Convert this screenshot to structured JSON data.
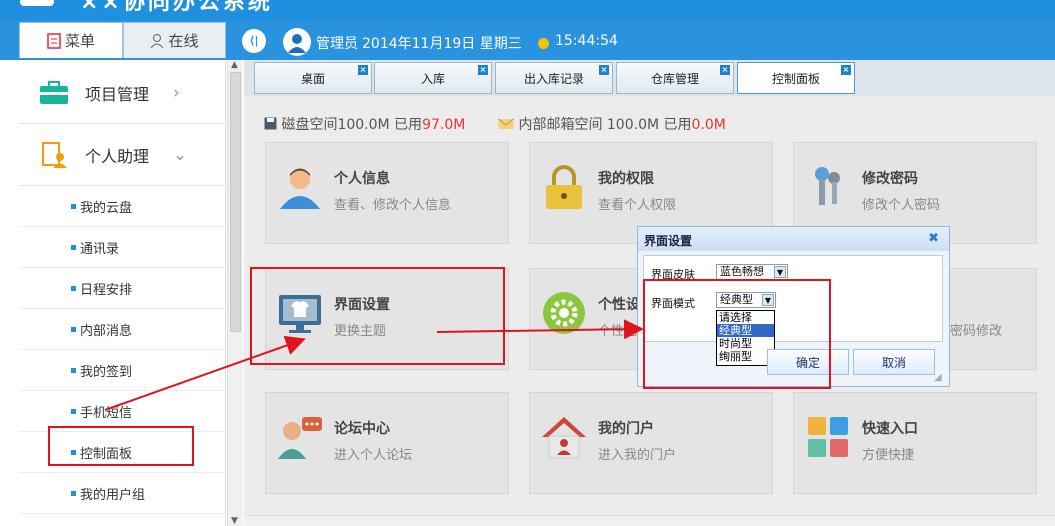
{
  "header": {
    "app_title": "××协同办公系统",
    "collapse_symbol": "⟨|",
    "user_role": "管理员",
    "date": "2014年11月19日 星期三",
    "time": "15:44:54"
  },
  "left_tabs": {
    "menu": "菜单",
    "online": "在线"
  },
  "sidebar": {
    "groups": [
      {
        "label": "项目管理",
        "icon": "briefcase-icon"
      },
      {
        "label": "个人助理",
        "icon": "person-doc-icon"
      }
    ],
    "items": [
      "我的云盘",
      "通讯录",
      "日程安排",
      "内部消息",
      "我的签到",
      "手机短信",
      "控制面板",
      "我的用户组"
    ]
  },
  "page_tabs": [
    "桌面",
    "入库",
    "出入库记录",
    "仓库管理",
    "控制面板"
  ],
  "storage": {
    "disk_label": "磁盘空间100.0M 已用",
    "disk_used": "97.0M",
    "mail_label": "内部邮箱空间 100.0M 已用",
    "mail_used": "0.0M"
  },
  "cards": [
    {
      "title": "个人信息",
      "desc": "查看、修改个人信息",
      "icon": "user-icon"
    },
    {
      "title": "我的权限",
      "desc": "查看个人权限",
      "icon": "lock-icon"
    },
    {
      "title": "修改密码",
      "desc": "修改个人密码",
      "icon": "keys-icon"
    },
    {
      "title": "界面设置",
      "desc": "更换主题",
      "icon": "monitor-shirt-icon"
    },
    {
      "title": "个性设",
      "desc": "个性化",
      "icon": "gear-icon"
    },
    {
      "title": "",
      "desc": "密码修改",
      "icon": ""
    },
    {
      "title": "论坛中心",
      "desc": "进入个人论坛",
      "icon": "forum-icon"
    },
    {
      "title": "我的门户",
      "desc": "进入我的门户",
      "icon": "house-icon"
    },
    {
      "title": "快速入口",
      "desc": "方便快捷",
      "icon": "tiles-icon"
    }
  ],
  "dialog": {
    "title": "界面设置",
    "close": "✖",
    "skin_label": "界面皮肤",
    "skin_value": "蓝色畅想",
    "mode_label": "界面模式",
    "mode_value": "经典型",
    "mode_options": [
      "请选择",
      "经典型",
      "时尚型",
      "绚丽型"
    ],
    "ok": "确定",
    "cancel": "取消"
  },
  "colors": {
    "accent": "#2a93df",
    "annotation": "#e0141e"
  }
}
